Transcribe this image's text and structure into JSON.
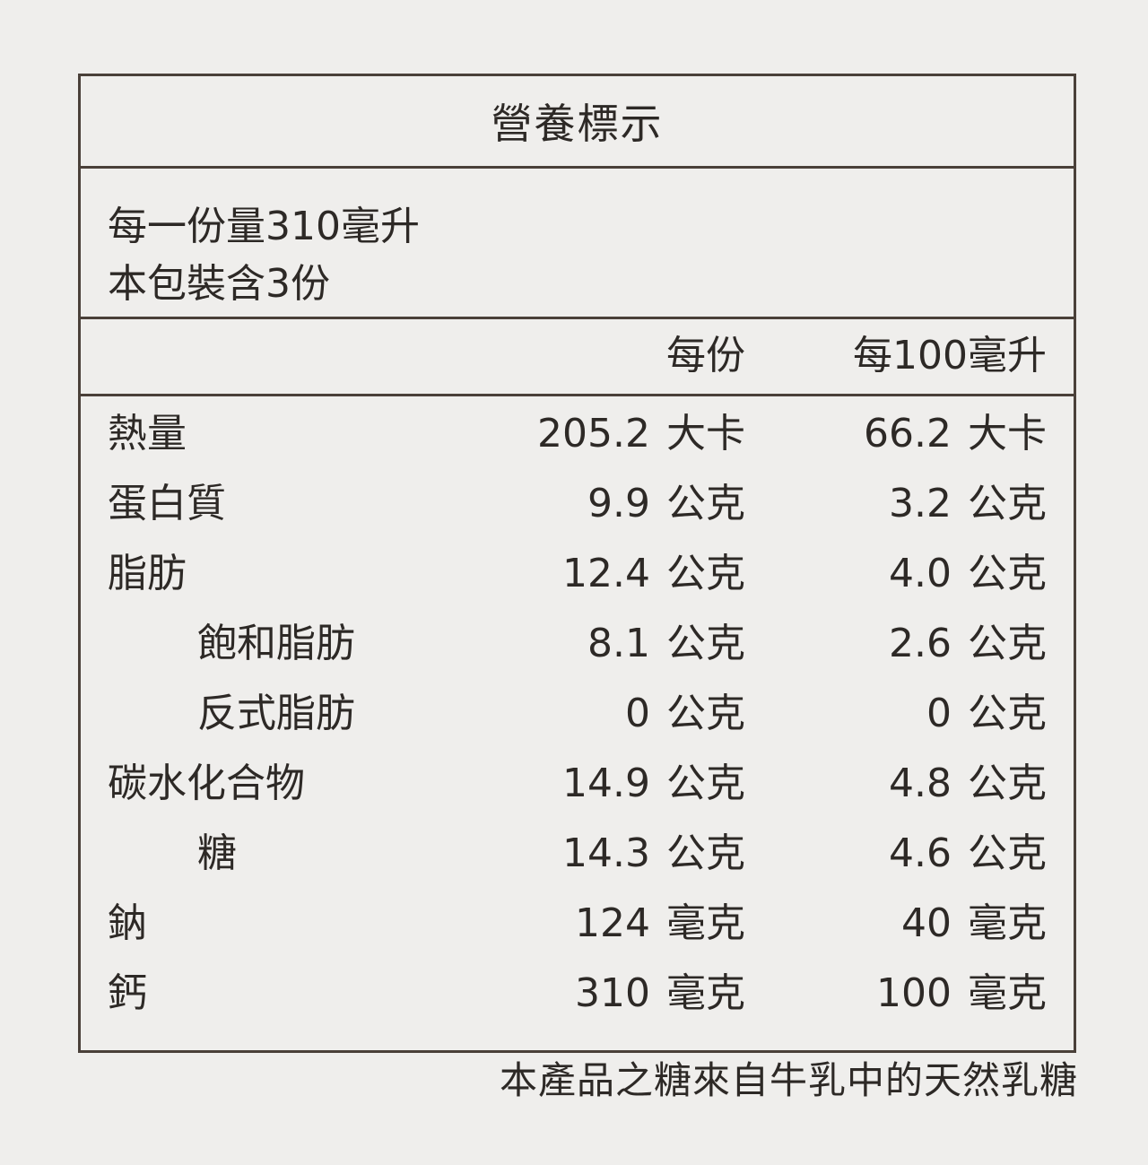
{
  "title": "營養標示",
  "serving_size": "每一份量310毫升",
  "servings_per_package": "本包裝含3份",
  "columns": {
    "per_serving": "每份",
    "per_100ml": "每100毫升"
  },
  "nutrients": [
    {
      "name": "熱量",
      "indent": false,
      "per_serving": "205.2",
      "per_serving_unit": "大卡",
      "per_100": "66.2",
      "per_100_unit": "大卡"
    },
    {
      "name": "蛋白質",
      "indent": false,
      "per_serving": "9.9",
      "per_serving_unit": "公克",
      "per_100": "3.2",
      "per_100_unit": "公克"
    },
    {
      "name": "脂肪",
      "indent": false,
      "per_serving": "12.4",
      "per_serving_unit": "公克",
      "per_100": "4.0",
      "per_100_unit": "公克"
    },
    {
      "name": "飽和脂肪",
      "indent": true,
      "per_serving": "8.1",
      "per_serving_unit": "公克",
      "per_100": "2.6",
      "per_100_unit": "公克"
    },
    {
      "name": "反式脂肪",
      "indent": true,
      "per_serving": "0",
      "per_serving_unit": "公克",
      "per_100": "0",
      "per_100_unit": "公克"
    },
    {
      "name": "碳水化合物",
      "indent": false,
      "per_serving": "14.9",
      "per_serving_unit": "公克",
      "per_100": "4.8",
      "per_100_unit": "公克"
    },
    {
      "name": "糖",
      "indent": true,
      "per_serving": "14.3",
      "per_serving_unit": "公克",
      "per_100": "4.6",
      "per_100_unit": "公克"
    },
    {
      "name": "鈉",
      "indent": false,
      "per_serving": "124",
      "per_serving_unit": "毫克",
      "per_100": "40",
      "per_100_unit": "毫克"
    },
    {
      "name": "鈣",
      "indent": false,
      "per_serving": "310",
      "per_serving_unit": "毫克",
      "per_100": "100",
      "per_100_unit": "毫克"
    }
  ],
  "footnote": "本產品之糖來自牛乳中的天然乳糖"
}
